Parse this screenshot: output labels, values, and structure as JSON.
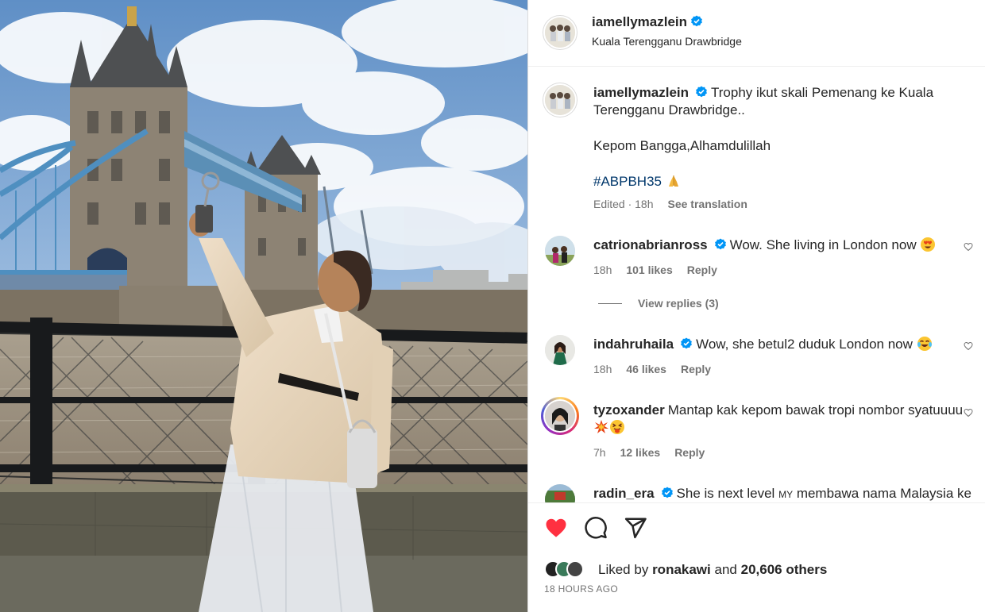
{
  "post": {
    "author": "iamellymazlein",
    "location": "Kuala Terengganu Drawbridge",
    "caption_line1": "Trophy ikut skali Pemenang ke Kuala Terengganu Drawbridge..",
    "caption_line2": "Kepom Bangga,Alhamdulillah",
    "hashtag": "#ABPBH35",
    "edited": "Edited · 18h",
    "see_translation": "See translation"
  },
  "comments": [
    {
      "user": "catrionabrianross",
      "text": "Wow. She living in London now",
      "time": "18h",
      "likes": "101 likes",
      "reply": "Reply",
      "emoji": "heart-eyes-emoji"
    },
    {
      "user": "indahruhaila",
      "text": "Wow, she betul2 duduk London now",
      "time": "18h",
      "likes": "46 likes",
      "reply": "Reply",
      "emoji": "tears-of-joy-emoji"
    },
    {
      "user": "tyzoxander",
      "text": "Mantap kak kepom bawak tropi nombor syatuuuu",
      "time": "7h",
      "likes": "12 likes",
      "reply": "Reply",
      "emoji": "collision-emoji"
    },
    {
      "user": "radin_era",
      "text": "She is next level",
      "flag": "MY",
      "text_after": "membawa nama Malaysia ke"
    }
  ],
  "view_replies": "View replies (3)",
  "likes": {
    "liked_by_prefix": "Liked by",
    "liked_by_user": "ronakawi",
    "and": "and",
    "others": "20,606 others"
  },
  "time_ago": "18 HOURS AGO",
  "colors": {
    "like_red": "#ff3040",
    "verified_blue": "#0095f6",
    "hashtag": "#00376b",
    "muted": "#737373"
  }
}
